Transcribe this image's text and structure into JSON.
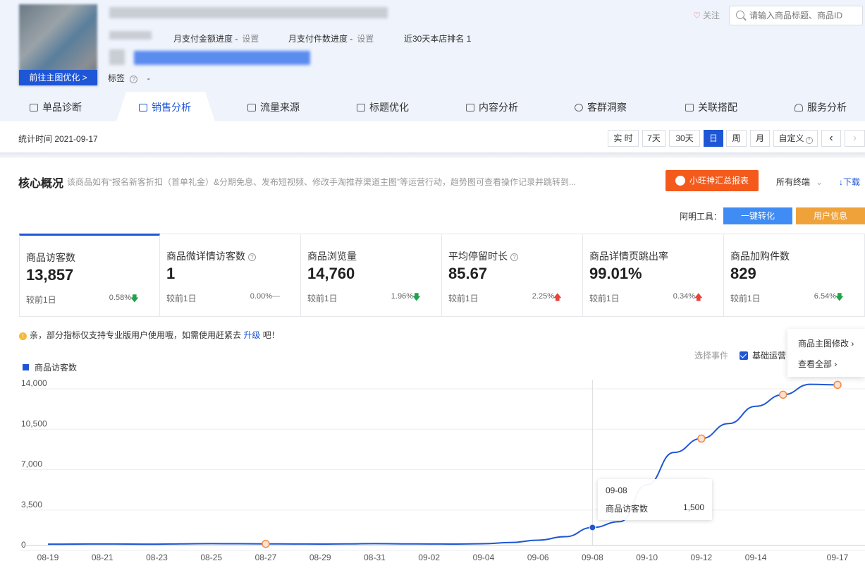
{
  "product": {
    "main_image_button": "前往主图优化 >",
    "monthly_amount_progress": "月支付金额进度 -",
    "monthly_count_progress": "月支付件数进度 -",
    "set_label": "设置",
    "rank_text": "近30天本店排名 1",
    "tags_label": "标签",
    "tags_value": "-"
  },
  "header_actions": {
    "follow_label": "关注",
    "search_placeholder": "请输入商品标题、商品ID"
  },
  "tabs": [
    {
      "label": "单品诊断"
    },
    {
      "label": "销售分析",
      "active": true
    },
    {
      "label": "流量来源"
    },
    {
      "label": "标题优化"
    },
    {
      "label": "内容分析"
    },
    {
      "label": "客群洞察"
    },
    {
      "label": "关联搭配"
    },
    {
      "label": "服务分析"
    }
  ],
  "time_bar": {
    "stat_time": "统计时间 2021-09-17",
    "buttons": [
      "实 时",
      "7天",
      "30天",
      "日",
      "周",
      "月",
      "自定义"
    ],
    "active": "日",
    "prev": "‹",
    "next": "›"
  },
  "core": {
    "title": "核心概况",
    "description": "该商品如有“报名新客折扣（首单礼金）&分期免息、发布短视频、修改手淘推荐渠道主图”等运营行动，趋势图可查看操作记录并跳转到...",
    "report_button": "小旺神汇总报表",
    "terminals": "所有终端",
    "download": "下载",
    "tools_label": "阿明工具：",
    "tool_convert": "一键转化",
    "tool_user_info": "用户信息"
  },
  "metrics": [
    {
      "label": "商品访客数",
      "value": "13,857",
      "compare": "较前1日",
      "pct": "0.58%",
      "dir": "down",
      "help": false
    },
    {
      "label": "商品微详情访客数",
      "value": "1",
      "compare": "较前1日",
      "pct": "0.00%",
      "dir": "flat",
      "help": true
    },
    {
      "label": "商品浏览量",
      "value": "14,760",
      "compare": "较前1日",
      "pct": "1.96%",
      "dir": "down",
      "help": false
    },
    {
      "label": "平均停留时长",
      "value": "85.67",
      "compare": "较前1日",
      "pct": "2.25%",
      "dir": "up",
      "help": true
    },
    {
      "label": "商品详情页跳出率",
      "value": "99.01%",
      "compare": "较前1日",
      "pct": "0.34%",
      "dir": "up",
      "help": false
    },
    {
      "label": "商品加购件数",
      "value": "829",
      "compare": "较前1日",
      "pct": "6.54%",
      "dir": "down",
      "help": false
    }
  ],
  "notice": {
    "text_before": "亲，部分指标仅支持专业版用户使用哦，如需使用赶紧去",
    "link": "升级",
    "text_after": "吧！"
  },
  "events": {
    "select_label": "选择事件",
    "basic_ops": "基础运营",
    "popup_items": [
      "商品主图修改 ›",
      "查看全部 ›"
    ]
  },
  "tooltip": {
    "date": "09-08",
    "name": "商品访客数",
    "value": "1,500"
  },
  "chart_data": {
    "type": "line",
    "legend": [
      "商品访客数"
    ],
    "y_ticks": [
      "14,000",
      "10,500",
      "7,000",
      "3,500",
      "0"
    ],
    "ylim": [
      0,
      14000
    ],
    "x_labels": [
      "08-19",
      "08-21",
      "08-23",
      "08-25",
      "08-27",
      "08-29",
      "08-31",
      "09-02",
      "09-04",
      "09-06",
      "09-08",
      "09-10",
      "09-12",
      "09-14",
      "09-17"
    ],
    "series": [
      {
        "name": "商品访客数",
        "color": "#1e56d6",
        "x": [
          "08-19",
          "08-20",
          "08-21",
          "08-22",
          "08-23",
          "08-24",
          "08-25",
          "08-26",
          "08-27",
          "08-28",
          "08-29",
          "08-30",
          "08-31",
          "09-01",
          "09-02",
          "09-03",
          "09-04",
          "09-05",
          "09-06",
          "09-07",
          "09-08",
          "09-09",
          "09-10",
          "09-11",
          "09-12",
          "09-13",
          "09-14",
          "09-15",
          "09-16",
          "09-17"
        ],
        "values": [
          50,
          60,
          70,
          60,
          50,
          80,
          100,
          90,
          80,
          70,
          60,
          80,
          100,
          80,
          70,
          60,
          90,
          200,
          400,
          700,
          1500,
          2000,
          5200,
          8000,
          9200,
          10500,
          12000,
          13000,
          13900,
          13857
        ]
      }
    ],
    "event_markers": [
      "08-27",
      "09-12",
      "09-15",
      "09-17"
    ],
    "highlight": "09-08"
  }
}
